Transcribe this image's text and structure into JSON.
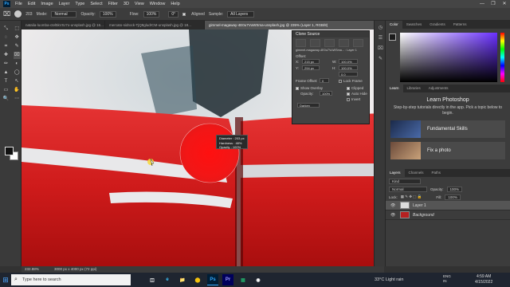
{
  "app": {
    "logo": "Ps"
  },
  "menu": [
    "File",
    "Edit",
    "Image",
    "Layer",
    "Type",
    "Select",
    "Filter",
    "3D",
    "View",
    "Window",
    "Help"
  ],
  "window_controls": [
    "—",
    "❐",
    "✕"
  ],
  "options_bar": {
    "brush_size": "203",
    "mode_label": "Mode:",
    "mode_value": "Normal",
    "opacity_label": "Opacity:",
    "opacity_value": "100%",
    "flow_label": "Flow:",
    "flow_value": "100%",
    "angle_value": "0°",
    "aligned_label": "Aligned",
    "sample_label": "Sample:",
    "sample_value": "All Layers"
  },
  "tabs": [
    {
      "label": "natalia-luomba-ctel5kVIU7o-unsplash.jpg @ 16...",
      "active": false
    },
    {
      "label": "mercato-sidrock-TjQ9gludrCM-unsplash.jpg @ 18...",
      "active": false
    },
    {
      "label": "gimmel-magaway-4E0u7VuWSma-unsplash.jpg @ 235% (Layer 1, RGB/8)",
      "active": true
    }
  ],
  "tools": [
    "⤡",
    "⬚",
    "◌",
    "✥",
    "⌗",
    "✎",
    "✚",
    "⌧",
    "✏",
    "◐",
    "▲",
    "◯",
    "T",
    "↖",
    "▭",
    "✋",
    "🔍",
    "⋯"
  ],
  "clone_source": {
    "title": "Clone Source",
    "file_label": "gimmel-magaway-4E0u7VuWSma... : Layer 1",
    "offset_label": "Offset:",
    "x_label": "X:",
    "x_value": "215 px",
    "y_label": "Y:",
    "y_value": "294 px",
    "w_label": "W:",
    "w_value": "100.0%",
    "h_label": "H:",
    "h_value": "100.0%",
    "angle_value": "0.0",
    "frame_offset_label": "Frame Offset:",
    "frame_offset_value": "0",
    "lock_frame_label": "Lock Frame",
    "show_overlay_label": "Show Overlay",
    "clipped_label": "Clipped",
    "opacity_label": "Opacity:",
    "opacity_value": "100%",
    "auto_hide_label": "Auto Hide",
    "invert_label": "Invert",
    "blend_value": "Darken"
  },
  "brush_tooltip": {
    "diameter": "Diameter : 203 px",
    "hardness": "Hardness : 48%",
    "opacity": "Opacity : 100%"
  },
  "status_bar": {
    "zoom": "232.88%",
    "doc": "3000 px x 4000 px (72 ppi)"
  },
  "color_panel": {
    "tabs": [
      "Color",
      "Swatches",
      "Gradients",
      "Patterns"
    ]
  },
  "learn_panel": {
    "tabs": [
      "Learn",
      "Libraries",
      "Adjustments"
    ],
    "title": "Learn Photoshop",
    "description": "Step-by-step tutorials directly in the app. Pick a topic below to begin.",
    "cards": [
      "Fundamental Skills",
      "Fix a photo"
    ]
  },
  "layers_panel": {
    "tabs": [
      "Layers",
      "Channels",
      "Paths"
    ],
    "kind_label": "Kind",
    "blend_value": "Normal",
    "opacity_label": "Opacity:",
    "opacity_value": "100%",
    "lock_label": "Lock:",
    "fill_label": "Fill:",
    "fill_value": "100%",
    "layers": [
      {
        "name": "Layer 1",
        "selected": true
      },
      {
        "name": "Background",
        "selected": false
      }
    ]
  },
  "taskbar": {
    "search_placeholder": "Type here to search",
    "apps": [
      "◫",
      "e",
      "📁",
      "⬤",
      "Ps",
      "Pr",
      "▦",
      "◉"
    ],
    "weather": "33°C  Light rain",
    "lang": "ENG\nIN",
    "time": "4:59 AM",
    "date": "4/15/2022"
  },
  "colors": {
    "accent": "#31a8ff",
    "clone_brush": "#ff1a1a",
    "paint_red": "#d61a1a"
  }
}
